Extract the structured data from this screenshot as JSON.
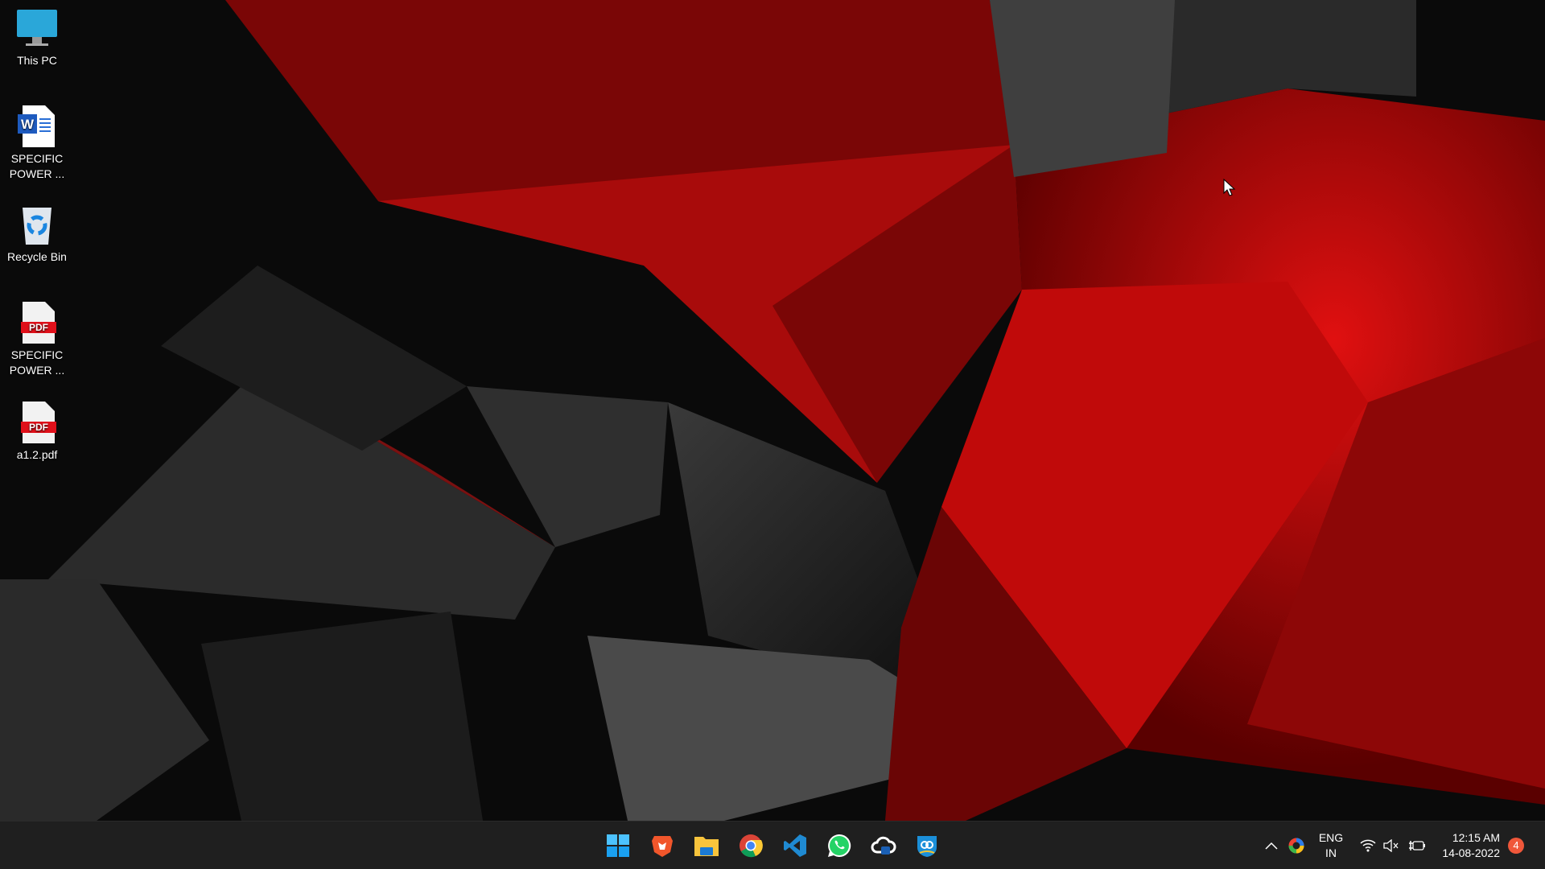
{
  "desktop": {
    "icons": [
      {
        "label": "This PC",
        "icon": "monitor-icon"
      },
      {
        "label": "SPECIFIC POWER ...",
        "icon": "word-document-icon"
      },
      {
        "label": "Recycle Bin",
        "icon": "recycle-bin-icon"
      },
      {
        "label": "SPECIFIC POWER ...",
        "icon": "pdf-document-icon",
        "badge": "PDF"
      },
      {
        "label": "a1.2.pdf",
        "icon": "pdf-document-icon",
        "badge": "PDF"
      }
    ]
  },
  "taskbar": {
    "apps": [
      "start-icon",
      "brave-icon",
      "file-explorer-icon",
      "chrome-icon",
      "vscode-icon",
      "whatsapp-icon",
      "cloud-shell-icon",
      "vpn-shield-icon"
    ],
    "tray": {
      "language_line1": "ENG",
      "language_line2": "IN",
      "time": "12:15 AM",
      "date": "14-08-2022",
      "notification_count": "4"
    }
  },
  "colors": {
    "accent_red": "#c40a0a",
    "taskbar": "#1f1f1f",
    "badge": "#f0573a"
  }
}
